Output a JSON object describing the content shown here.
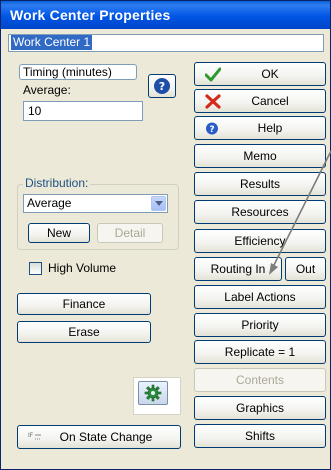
{
  "window": {
    "title": "Work Center Properties"
  },
  "name_field": {
    "value": "Work Center 1"
  },
  "timing": {
    "label": "Timing (minutes)",
    "average_label": "Average:",
    "average_value": "10"
  },
  "distribution": {
    "label": "Distribution:",
    "selected": "Average",
    "new_label": "New",
    "detail_label": "Detail"
  },
  "high_volume": {
    "label": "High Volume",
    "checked": false
  },
  "left_buttons": {
    "finance": "Finance",
    "erase": "Erase",
    "on_state_change": "On State Change"
  },
  "right_buttons": {
    "ok": "OK",
    "cancel": "Cancel",
    "help": "Help",
    "memo": "Memo",
    "results": "Results",
    "resources": "Resources",
    "efficiency": "Efficiency",
    "routing_in": "Routing In",
    "out": "Out",
    "label_actions": "Label Actions",
    "priority": "Priority",
    "replicate": "Replicate = 1",
    "contents": "Contents",
    "graphics": "Graphics",
    "shifts": "Shifts"
  },
  "colors": {
    "titlebar": "#0055e5",
    "face": "#ece9d8",
    "distribution_label": "#1c5180",
    "check_green": "#2e9a2e",
    "cancel_red": "#d42a1a",
    "arrow": "#808080"
  }
}
